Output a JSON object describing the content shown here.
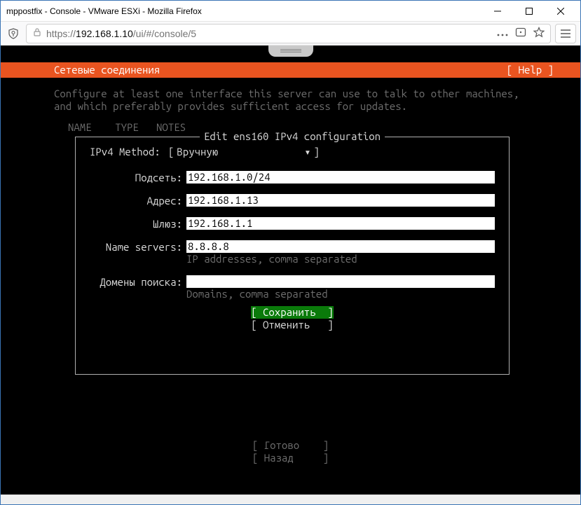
{
  "window": {
    "title": "mppostfix - Console - VMware ESXi - Mozilla Firefox"
  },
  "toolbar": {
    "url_host": "192.168.1.10",
    "url_path": "/ui/#/console/5",
    "url_scheme": "https://"
  },
  "header": {
    "title": "Сетевые соединения",
    "help": "[ Help ]"
  },
  "desc": {
    "line1": "Configure at least one interface this server can use to talk to other machines,",
    "line2": "and which preferably provides sufficient access for updates."
  },
  "columns": {
    "name": "NAME",
    "type": "TYPE",
    "notes": "NOTES"
  },
  "frame": {
    "title": "Edit ens160 IPv4 configuration",
    "method_label": "IPv4 Method:",
    "method_value": "Вручную",
    "fields": {
      "subnet": {
        "label": "Подсеть:",
        "value": "192.168.1.0/24"
      },
      "address": {
        "label": "Адрес:",
        "value": "192.168.1.13"
      },
      "gateway": {
        "label": "Шлюз:",
        "value": "192.168.1.1"
      },
      "dns": {
        "label": "Name servers:",
        "value": "8.8.8.8",
        "hint": "IP addresses, comma separated"
      },
      "search": {
        "label": "Домены поиска:",
        "value": "",
        "hint": "Domains, comma separated"
      }
    },
    "save": "Сохранить",
    "cancel": "Отменить"
  },
  "footer": {
    "done": "Готово",
    "back": "Назад"
  }
}
